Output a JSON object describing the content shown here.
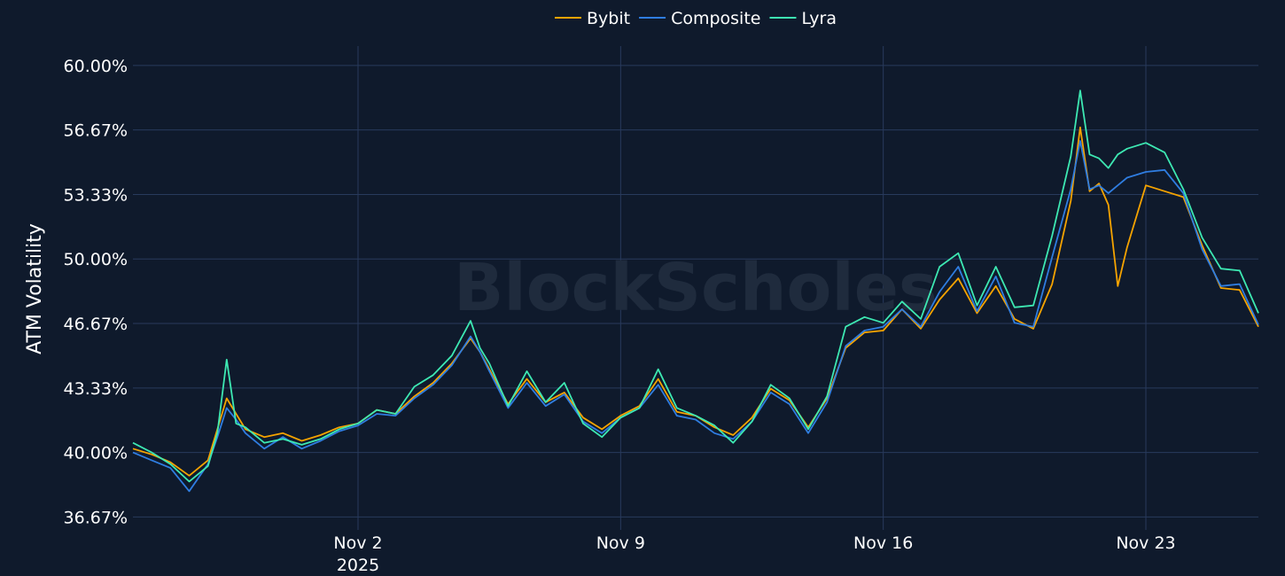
{
  "chart_data": {
    "type": "line",
    "title": "",
    "xlabel": "",
    "ylabel": "ATM Volatility",
    "watermark": "BlockScholes",
    "grid": true,
    "legend_position": "top-center",
    "x_range": [
      "2025-10-27T00:00",
      "2025-11-26T00:00"
    ],
    "y_range": [
      36.0,
      61.0
    ],
    "y_ticks": [
      {
        "value": 36.67,
        "label": "36.67%"
      },
      {
        "value": 40.0,
        "label": "40.00%"
      },
      {
        "value": 43.33,
        "label": "43.33%"
      },
      {
        "value": 46.67,
        "label": "46.67%"
      },
      {
        "value": 50.0,
        "label": "50.00%"
      },
      {
        "value": 53.33,
        "label": "53.33%"
      },
      {
        "value": 56.67,
        "label": "56.67%"
      },
      {
        "value": 60.0,
        "label": "60.00%"
      }
    ],
    "x_ticks": [
      {
        "value": "2025-11-02",
        "label": "Nov 2",
        "sublabel": "2025"
      },
      {
        "value": "2025-11-09",
        "label": "Nov 9",
        "sublabel": ""
      },
      {
        "value": "2025-11-16",
        "label": "Nov 16",
        "sublabel": ""
      },
      {
        "value": "2025-11-23",
        "label": "Nov 23",
        "sublabel": ""
      }
    ],
    "x": [
      "2025-10-27T00:00",
      "2025-10-27T12:00",
      "2025-10-28T00:00",
      "2025-10-28T12:00",
      "2025-10-29T00:00",
      "2025-10-29T06:00",
      "2025-10-29T12:00",
      "2025-10-29T18:00",
      "2025-10-30T00:00",
      "2025-10-30T12:00",
      "2025-10-31T00:00",
      "2025-10-31T12:00",
      "2025-11-01T00:00",
      "2025-11-01T12:00",
      "2025-11-02T00:00",
      "2025-11-02T12:00",
      "2025-11-03T00:00",
      "2025-11-03T12:00",
      "2025-11-04T00:00",
      "2025-11-04T12:00",
      "2025-11-05T00:00",
      "2025-11-05T06:00",
      "2025-11-05T12:00",
      "2025-11-06T00:00",
      "2025-11-06T12:00",
      "2025-11-07T00:00",
      "2025-11-07T12:00",
      "2025-11-08T00:00",
      "2025-11-08T12:00",
      "2025-11-09T00:00",
      "2025-11-09T12:00",
      "2025-11-10T00:00",
      "2025-11-10T12:00",
      "2025-11-11T00:00",
      "2025-11-11T12:00",
      "2025-11-12T00:00",
      "2025-11-12T12:00",
      "2025-11-13T00:00",
      "2025-11-13T12:00",
      "2025-11-14T00:00",
      "2025-11-14T12:00",
      "2025-11-15T00:00",
      "2025-11-15T12:00",
      "2025-11-16T00:00",
      "2025-11-16T12:00",
      "2025-11-17T00:00",
      "2025-11-17T12:00",
      "2025-11-18T00:00",
      "2025-11-18T12:00",
      "2025-11-19T00:00",
      "2025-11-19T12:00",
      "2025-11-20T00:00",
      "2025-11-20T12:00",
      "2025-11-21T00:00",
      "2025-11-21T06:00",
      "2025-11-21T12:00",
      "2025-11-21T18:00",
      "2025-11-22T00:00",
      "2025-11-22T06:00",
      "2025-11-22T12:00",
      "2025-11-23T00:00",
      "2025-11-23T12:00",
      "2025-11-24T00:00",
      "2025-11-24T12:00",
      "2025-11-25T00:00",
      "2025-11-25T12:00",
      "2025-11-26T00:00"
    ],
    "series": [
      {
        "name": "Bybit",
        "color": "#f5a300",
        "values": [
          40.2,
          39.9,
          39.5,
          38.8,
          39.6,
          41.2,
          42.8,
          42.0,
          41.2,
          40.8,
          41.0,
          40.6,
          40.9,
          41.3,
          41.5,
          42.2,
          42.0,
          42.9,
          43.6,
          44.6,
          45.9,
          45.2,
          44.3,
          42.5,
          43.8,
          42.6,
          43.1,
          41.8,
          41.2,
          41.9,
          42.4,
          43.8,
          42.1,
          41.9,
          41.3,
          40.9,
          41.8,
          43.3,
          42.7,
          41.3,
          42.8,
          45.4,
          46.2,
          46.3,
          47.4,
          46.4,
          47.9,
          49.0,
          47.2,
          48.6,
          46.9,
          46.4,
          48.7,
          53.0,
          56.8,
          53.5,
          53.9,
          52.8,
          48.6,
          50.6,
          53.8,
          53.5,
          53.2,
          50.7,
          48.5,
          48.4,
          46.5
        ]
      },
      {
        "name": "Composite",
        "color": "#2f7de0",
        "values": [
          40.0,
          39.6,
          39.2,
          38.0,
          39.4,
          40.8,
          42.3,
          41.7,
          41.0,
          40.2,
          40.8,
          40.2,
          40.6,
          41.1,
          41.4,
          42.0,
          41.9,
          42.8,
          43.5,
          44.5,
          46.0,
          45.2,
          44.2,
          42.3,
          43.6,
          42.4,
          43.0,
          41.6,
          41.0,
          41.8,
          42.3,
          43.5,
          41.9,
          41.7,
          41.0,
          40.7,
          41.6,
          43.1,
          42.5,
          41.0,
          42.6,
          45.5,
          46.3,
          46.5,
          47.4,
          46.5,
          48.3,
          49.6,
          47.3,
          49.1,
          46.7,
          46.5,
          50.1,
          53.6,
          56.1,
          53.6,
          53.8,
          53.4,
          53.8,
          54.2,
          54.5,
          54.6,
          53.4,
          50.5,
          48.6,
          48.7,
          46.6
        ]
      },
      {
        "name": "Lyra",
        "color": "#3de8b2",
        "values": [
          40.5,
          40.0,
          39.4,
          38.5,
          39.3,
          41.0,
          44.8,
          41.5,
          41.3,
          40.5,
          40.7,
          40.4,
          40.7,
          41.2,
          41.5,
          42.2,
          42.0,
          43.4,
          44.0,
          45.0,
          46.8,
          45.4,
          44.6,
          42.4,
          44.2,
          42.6,
          43.6,
          41.5,
          40.8,
          41.8,
          42.3,
          44.3,
          42.3,
          41.9,
          41.4,
          40.5,
          41.6,
          43.5,
          42.8,
          41.2,
          42.9,
          46.5,
          47.0,
          46.7,
          47.8,
          46.9,
          49.6,
          50.3,
          47.6,
          49.6,
          47.5,
          47.6,
          51.2,
          55.3,
          58.7,
          55.4,
          55.2,
          54.7,
          55.4,
          55.7,
          56.0,
          55.5,
          53.6,
          51.1,
          49.5,
          49.4,
          47.2
        ]
      }
    ]
  }
}
